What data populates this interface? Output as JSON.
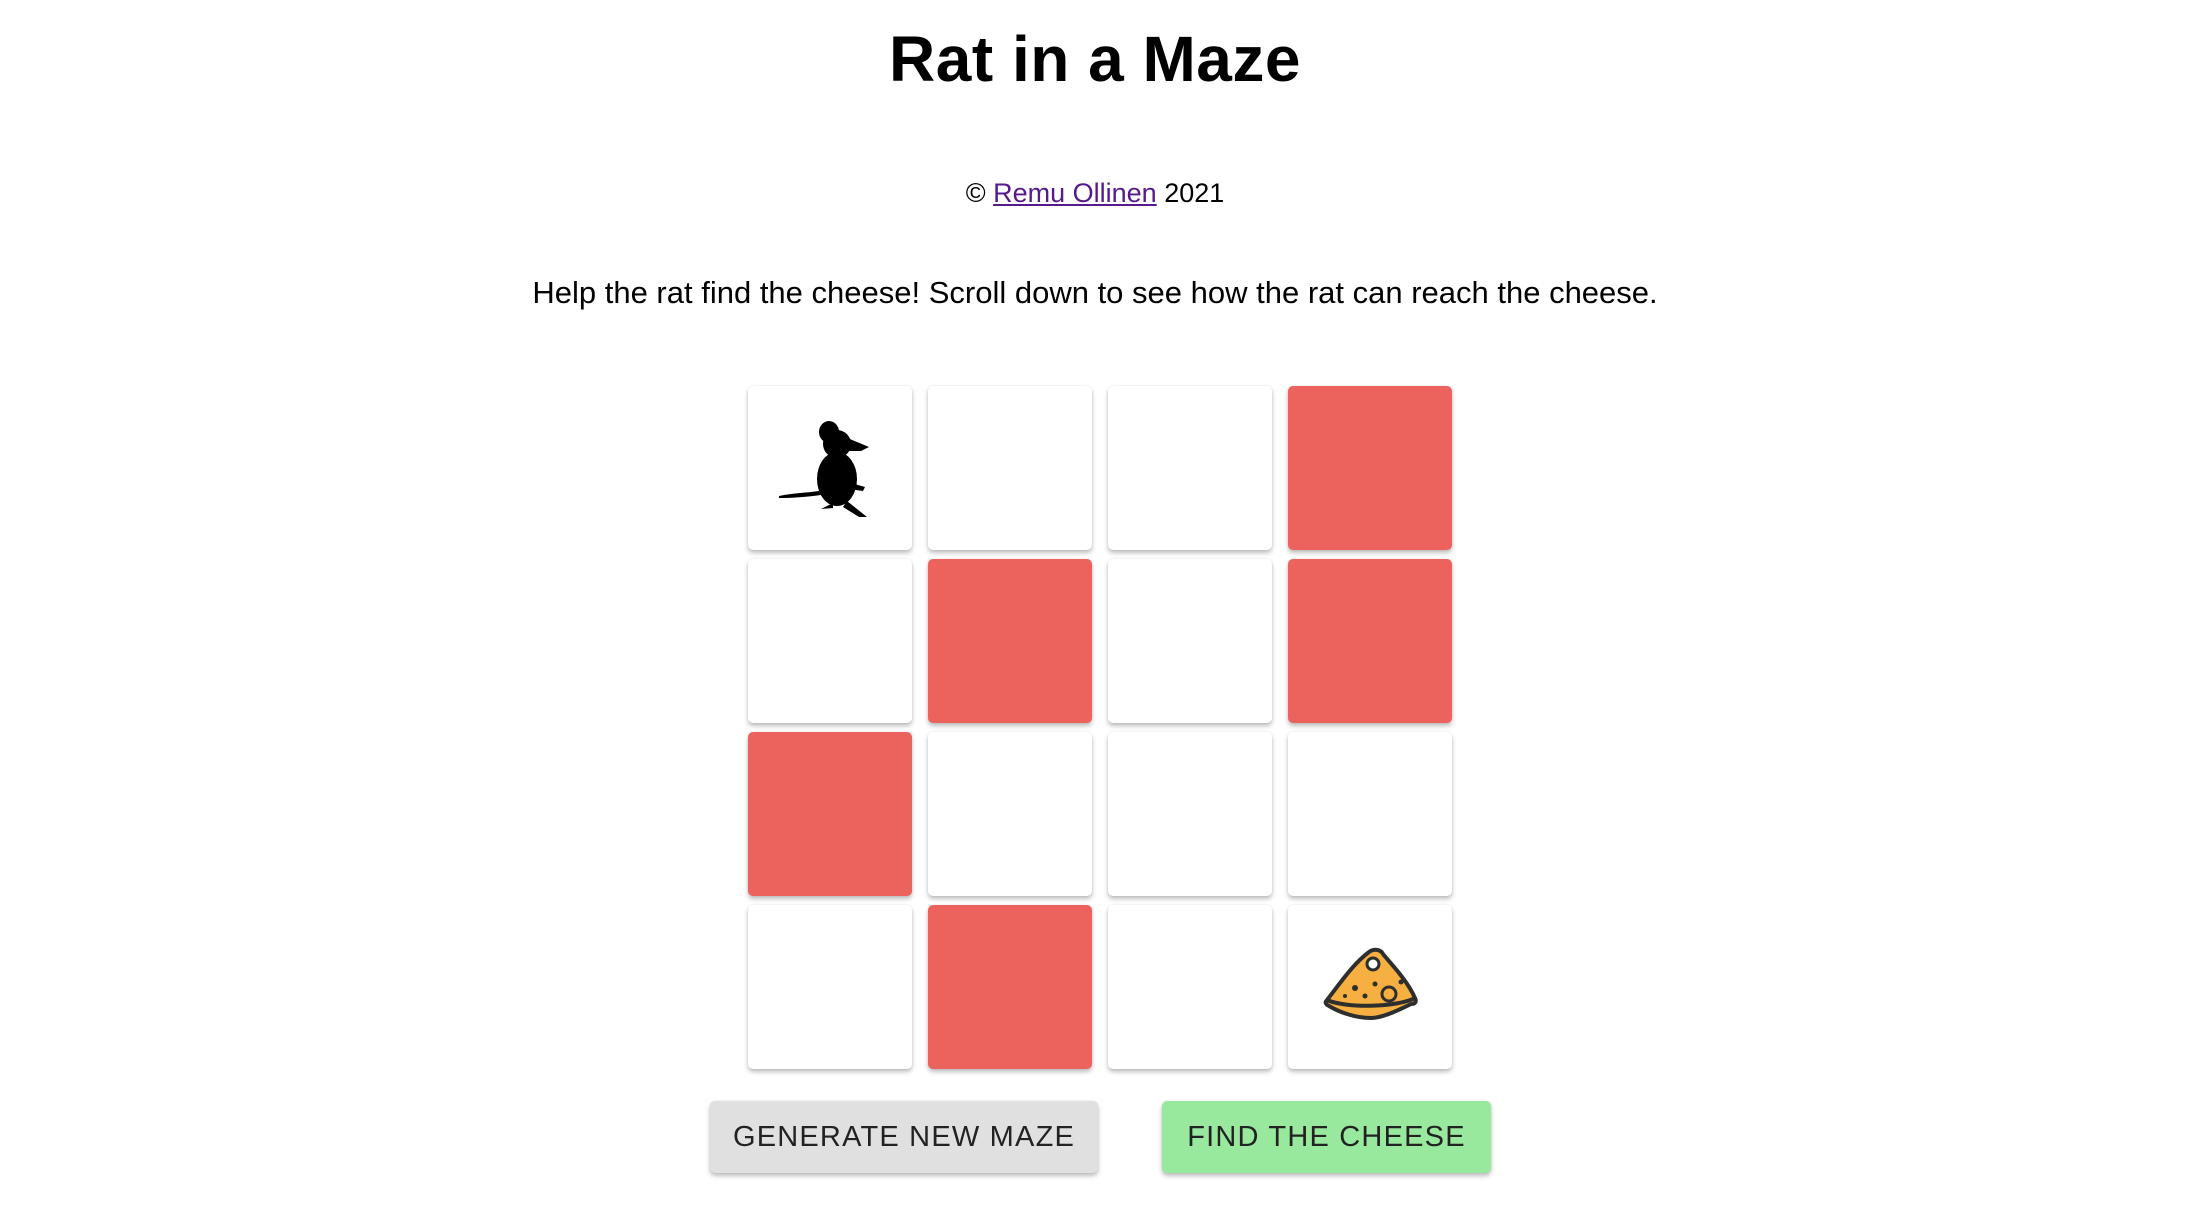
{
  "header": {
    "title": "Rat in a Maze"
  },
  "footer": {
    "copyright_symbol": "©",
    "author_link": "Remu Ollinen",
    "year": "2021"
  },
  "intro": {
    "text": "Help the rat find the cheese! Scroll down to see how the rat can reach the cheese."
  },
  "maze": {
    "rows": 4,
    "cols": 4,
    "wall_color": "#ec635e",
    "open_color": "#ffffff",
    "cells": [
      [
        "rat",
        "open",
        "open",
        "wall"
      ],
      [
        "open",
        "wall",
        "open",
        "wall"
      ],
      [
        "wall",
        "open",
        "open",
        "open"
      ],
      [
        "open",
        "wall",
        "open",
        "cheese"
      ]
    ],
    "start_icon": "rat-icon",
    "goal_icon": "cheese-icon"
  },
  "buttons": {
    "generate_label": "GENERATE NEW MAZE",
    "generate_color": "#e0e0e0",
    "find_label": "FIND THE CHEESE",
    "find_color": "#98e89e"
  }
}
